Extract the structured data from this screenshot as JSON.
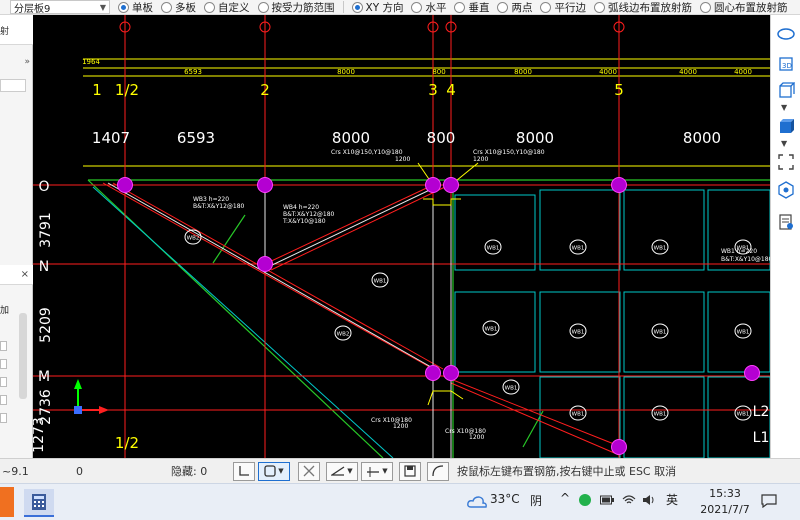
{
  "toolbar": {
    "layer_select": "分层板9",
    "options": [
      {
        "label": "单板",
        "selected": true
      },
      {
        "label": "多板",
        "selected": false
      },
      {
        "label": "自定义",
        "selected": false
      },
      {
        "label": "按受力筋范围",
        "selected": false
      },
      {
        "label": "XY 方向",
        "selected": true
      },
      {
        "label": "水平",
        "selected": false
      },
      {
        "label": "垂直",
        "selected": false
      },
      {
        "label": "两点",
        "selected": false
      },
      {
        "label": "平行边",
        "selected": false
      },
      {
        "label": "弧线边布置放射筋",
        "selected": false
      },
      {
        "label": "圆心布置放射筋",
        "selected": false
      }
    ]
  },
  "left_panel": {
    "button1": "射",
    "arrows": "»",
    "close_glyph": "×",
    "add_label": "加"
  },
  "drawing": {
    "axes_top": [
      "1",
      "1/2",
      "2",
      "3",
      "4",
      "5"
    ],
    "dims_small": [
      "1964",
      "6593",
      "8000",
      "800",
      "8000",
      "4000",
      "4000",
      "4000"
    ],
    "dims_large": [
      "1407",
      "6593",
      "8000",
      "800",
      "8000",
      "8000"
    ],
    "axes_left": [
      "O",
      "N",
      "M"
    ],
    "dims_left": [
      "3791",
      "5209",
      "2736",
      "1273"
    ],
    "axis_bottom": "1/2",
    "axes_right": [
      "L2",
      "L1"
    ],
    "beam_notes": [
      "WB3 h=220",
      "B&T:X&Y12@180",
      "WB4 h=220",
      "B&T:X&Y12@180",
      "T:X&Y10@180",
      "WB1 h=220",
      "B&T:X&Y10@180"
    ],
    "cross_notes": [
      "Crs X10@150,Y10@180",
      "1200",
      "Crs X10@150,Y10@180",
      "1200",
      "Crs X10@180",
      "1200",
      "Crs X10@180",
      "1200"
    ],
    "bubbles_main": [
      "WB2",
      "WB1",
      "WB2",
      "WB1"
    ],
    "bubbles_grid": [
      "WB1",
      "WB1",
      "WB1",
      "WB1",
      "WB1",
      "WB1",
      "WB1",
      "WB1",
      "WB1",
      "WB1",
      "WB1",
      "WB1",
      "WB1"
    ],
    "ucs": {
      "x": "X",
      "y": "Y"
    },
    "colors": {
      "axis": "#e00000",
      "beam": "#ffffff",
      "slab": "#00c8c8",
      "rebar": "#ff1e1e",
      "dim": "#ffff00",
      "column": "#b400d2",
      "edge": "#28c828"
    }
  },
  "status": {
    "coord": "~9.1",
    "value": "0",
    "hidden_label": "隐藏: 0",
    "prompt": "按鼠标左键布置钢筋,按右键中止或 ESC 取消"
  },
  "taskbar": {
    "temperature": "33°C",
    "weather": "阴",
    "lang": "英",
    "time": "15:33",
    "date": "2021/7/7",
    "chevron": "^"
  }
}
